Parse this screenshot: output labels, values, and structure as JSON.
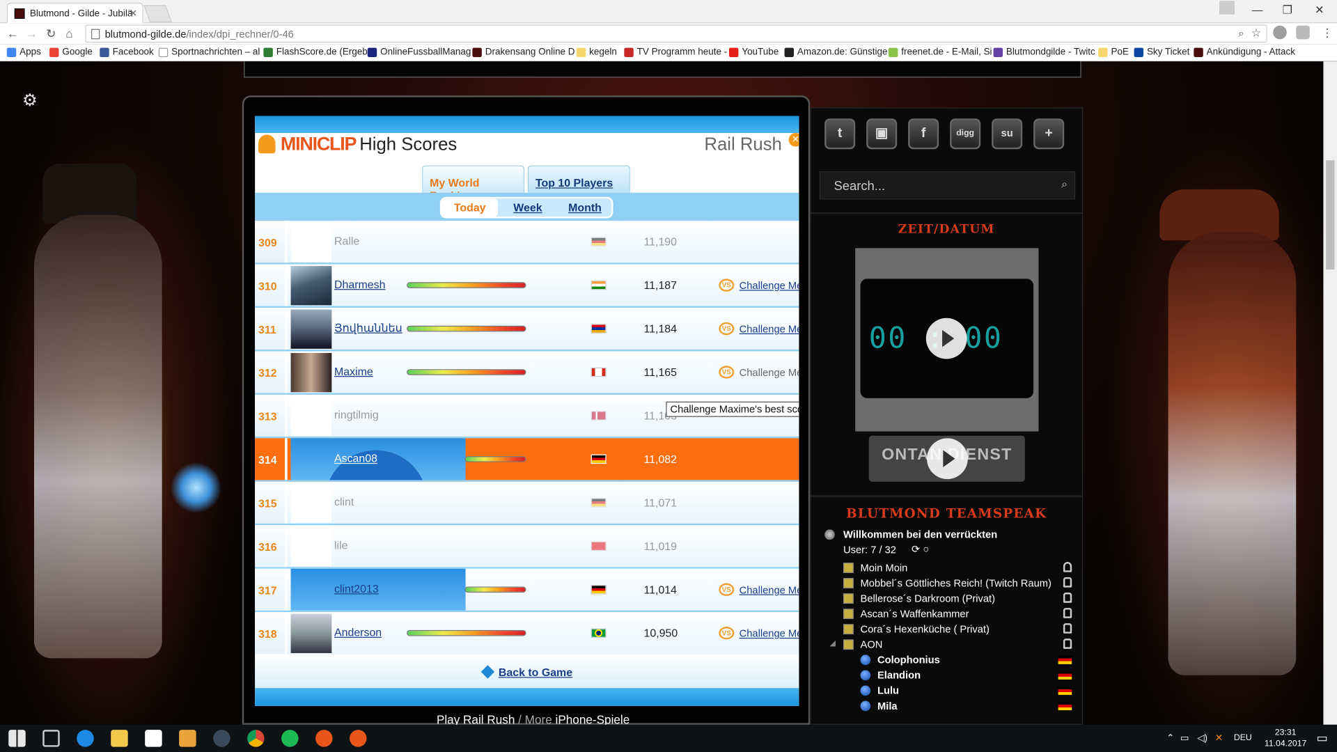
{
  "browser": {
    "tab_title": "Blutmond - Gilde - Jubilä",
    "url_host": "blutmond-gilde.de",
    "url_path": "/index/dpi_rechner/0-46",
    "bookmarks": [
      {
        "label": "Apps",
        "color": "#4285f4"
      },
      {
        "label": "Google",
        "color": "#ea4335"
      },
      {
        "label": "Facebook",
        "color": "#3b5998"
      },
      {
        "label": "Sportnachrichten – al",
        "color": "#ffffff"
      },
      {
        "label": "FlashScore.de (Ergeb",
        "color": "#2e7d32"
      },
      {
        "label": "OnlineFussballManag",
        "color": "#1a237e"
      },
      {
        "label": "Drakensang Online D",
        "color": "#4a0e0e"
      },
      {
        "label": "kegeln",
        "color": "#f5d76e"
      },
      {
        "label": "TV Programm heute -",
        "color": "#c62828"
      },
      {
        "label": "YouTube",
        "color": "#e62117"
      },
      {
        "label": "Amazon.de: Günstige",
        "color": "#222222"
      },
      {
        "label": "freenet.de - E-Mail, Si",
        "color": "#8bc34a"
      },
      {
        "label": "Blutmondgilde - Twitc",
        "color": "#6441a5"
      },
      {
        "label": "PoE",
        "color": "#f5d76e"
      },
      {
        "label": "Sky Ticket",
        "color": "#0d47a1"
      },
      {
        "label": "Ankündigung - Attack",
        "color": "#4a0e0e"
      }
    ]
  },
  "highscores": {
    "brand": "MINICLIP",
    "heading": "High Scores",
    "game": "Rail Rush",
    "tabs": [
      "My World Ranking",
      "Top 10 Players"
    ],
    "periods": [
      "Today",
      "Week",
      "Month"
    ],
    "rows": [
      {
        "rank": "309",
        "name": "Ralle",
        "score": "11,190",
        "flag": "de",
        "linked": false,
        "bar": false,
        "challenge": ""
      },
      {
        "rank": "310",
        "name": "Dharmesh",
        "score": "11,187",
        "flag": "in",
        "linked": true,
        "bar": true,
        "challenge": "Challenge Me!"
      },
      {
        "rank": "311",
        "name": "Յովհաննես",
        "score": "11,184",
        "flag": "am",
        "linked": true,
        "bar": true,
        "challenge": "Challenge Me!"
      },
      {
        "rank": "312",
        "name": "Maxime",
        "score": "11,165",
        "flag": "ca",
        "linked": true,
        "bar": true,
        "challenge": "Challenge Me!"
      },
      {
        "rank": "313",
        "name": "ringtilmig",
        "score": "11,103",
        "flag": "dk",
        "linked": false,
        "bar": false,
        "challenge": ""
      },
      {
        "rank": "314",
        "name": "Ascan08",
        "score": "11,082",
        "flag": "de",
        "linked": true,
        "bar": true,
        "challenge": "",
        "me": true
      },
      {
        "rank": "315",
        "name": "clint",
        "score": "11,071",
        "flag": "de",
        "linked": false,
        "bar": false,
        "challenge": ""
      },
      {
        "rank": "316",
        "name": "lile",
        "score": "11,019",
        "flag": "tr",
        "linked": false,
        "bar": false,
        "challenge": ""
      },
      {
        "rank": "317",
        "name": "clint2013",
        "score": "11,014",
        "flag": "de",
        "linked": true,
        "bar": true,
        "challenge": "Challenge Me!"
      },
      {
        "rank": "318",
        "name": "Anderson",
        "score": "10,950",
        "flag": "br",
        "linked": true,
        "bar": true,
        "challenge": "Challenge Me!"
      }
    ],
    "tooltip": "Challenge Maxime's best score",
    "back": "Back to Game",
    "footer_play": "Play Rail Rush",
    "footer_sep": " / More ",
    "footer_more": "iPhone-Spiele"
  },
  "sidebar": {
    "social": [
      "t",
      "▣",
      "f",
      "digg",
      "su",
      "+"
    ],
    "search_placeholder": "Search...",
    "time_title": "ZEIT/DATUM",
    "clock_display": "00 : 00",
    "banner": "ONTAN DIENST",
    "ts_title": "BLUTMOND TEAMSPEAK",
    "ts_server": "Willkommen bei den verrückten",
    "ts_users": "User: 7 / 32",
    "ts_channels": [
      "Moin Moin",
      "Mobbel´s Göttliches Reich! (Twitch Raum)",
      "Bellerose´s Darkroom (Privat)",
      "Ascan´s Waffenkammer",
      "Cora´s Hexenküche ( Privat)",
      "AON"
    ],
    "ts_members": [
      "Colophonius",
      "Elandion",
      "Lulu",
      "Mila"
    ]
  },
  "taskbar": {
    "lang": "DEU",
    "time": "23:31",
    "date": "11.04.2017"
  }
}
